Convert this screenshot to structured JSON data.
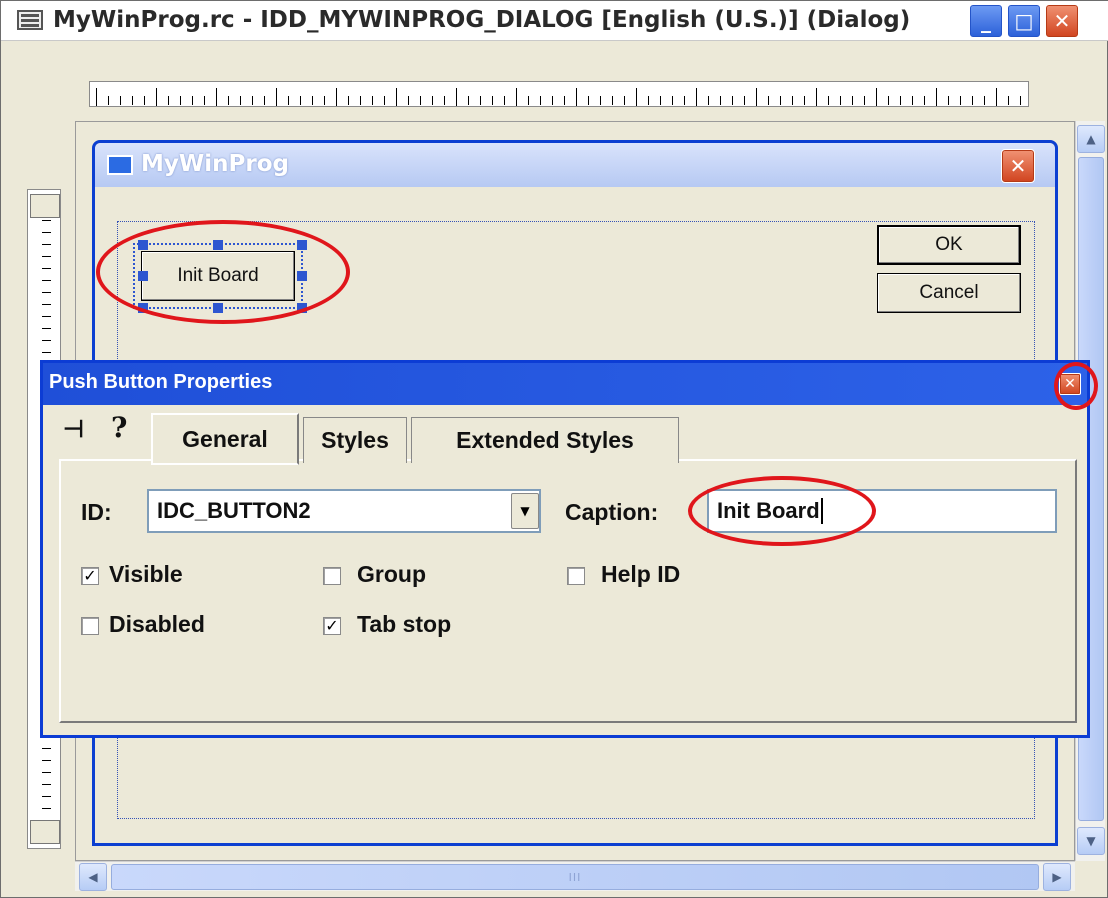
{
  "window": {
    "title": "MyWinProg.rc - IDD_MYWINPROG_DIALOG [English (U.S.)] (Dialog)",
    "controls": {
      "minimize": "_",
      "maximize": "□",
      "close": "✕"
    }
  },
  "design_dialog": {
    "title": "MyWinProg",
    "ok_label": "OK",
    "cancel_label": "Cancel",
    "selected_button_label": "Init Board"
  },
  "properties": {
    "title": "Push Button Properties",
    "pin_glyph": "⊣",
    "help_glyph": "?",
    "tabs": [
      "General",
      "Styles",
      "Extended Styles"
    ],
    "active_tab": "General",
    "id_label": "ID:",
    "id_value": "IDC_BUTTON2",
    "caption_label": "Caption:",
    "caption_value": "Init Board",
    "checkboxes": [
      {
        "label": "Visible",
        "checked": true
      },
      {
        "label": "Group",
        "checked": false
      },
      {
        "label": "Help ID",
        "checked": false
      },
      {
        "label": "Disabled",
        "checked": false
      },
      {
        "label": "Tab stop",
        "checked": true
      }
    ]
  },
  "scroll_glyphs": {
    "up": "▲",
    "down": "▼",
    "left": "◀",
    "right": "▶",
    "grip": "III"
  },
  "colors": {
    "highlight_ring": "#e0161b",
    "xp_title_blue": "#0c3cd4",
    "dialog_face": "#ECE9D8"
  }
}
